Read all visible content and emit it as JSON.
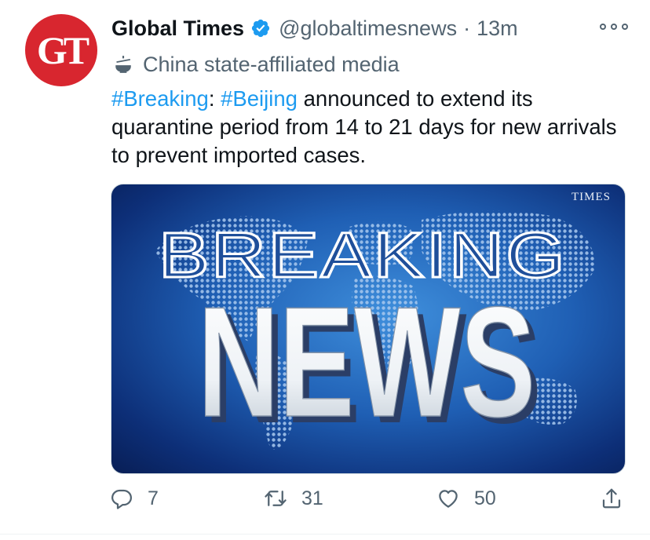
{
  "tweet": {
    "avatar_text": "GT",
    "display_name": "Global Times",
    "handle": "@globaltimesnews",
    "separator": "·",
    "time": "13m",
    "affiliation": "China state-affiliated media",
    "text": {
      "hashtag1": "#Breaking",
      "colon": ":",
      "hashtag2": "#Beijing",
      "rest": " announced to extend its quarantine period from 14 to 21 days for new arrivals to prevent imported cases."
    },
    "image": {
      "watermark": "TIMES",
      "headline_top": "BREAKING",
      "headline_bottom": "NEWS"
    },
    "actions": {
      "replies": "7",
      "retweets": "31",
      "likes": "50"
    }
  },
  "colors": {
    "link": "#1d9bf0",
    "verified": "#1d9bf0",
    "avatar_bg": "#d8262f",
    "muted": "#536471"
  },
  "icons": [
    "verified-badge-icon",
    "more-icon",
    "state-media-icon",
    "reply-icon",
    "retweet-icon",
    "like-icon",
    "share-icon"
  ]
}
